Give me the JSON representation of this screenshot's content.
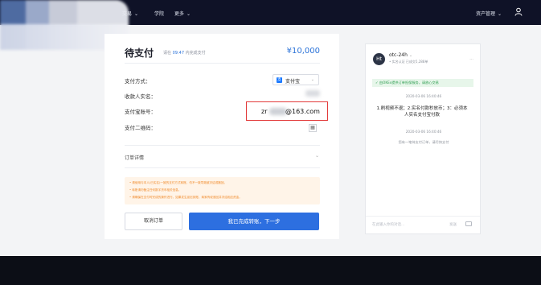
{
  "nav": {
    "items": [
      "交易",
      "学院",
      "更多"
    ],
    "asset_mgmt": "资产管理"
  },
  "order": {
    "title": "待支付",
    "subtitle_pre": "请在",
    "subtitle_time": "09:47",
    "subtitle_post": "内完成支付",
    "amount": "¥10,000",
    "labels": {
      "method": "支付方式：",
      "payee": "收款人实名：",
      "account": "支付宝账号：",
      "qrcode": "支付二维码："
    },
    "method_value": "支付宝",
    "account_prefix": "zr",
    "account_suffix": "@163.com",
    "order_detail": "订单详情",
    "notices": [
      "• 请使用与本人(已实名)一致的支付方式转账，勿不一致导致被冻结或撤回。",
      "• 转账请勿备注任何数字货币相关信息。",
      "• 请确保在支付时完成的操作进行。如果发生延迟到账，商家有权追回并冻结相应资金。"
    ],
    "cancel": "取消订单",
    "confirm": "我已完成转账，下一步"
  },
  "chat": {
    "avatar_text": "Ht",
    "name": "otc-24h",
    "meta": "• 实名认证  已成交5,288单",
    "banner": "✓ 由OKEx提供订单担保服务，请放心交易",
    "ts1": "2020-03-06 16:40:46",
    "message": "1.刷视频不退；2.实名付款秒放币；3：必须本人实名支付宝付款",
    "ts2": "2020-03-06 16:40:46",
    "system": "您有一笔待支付订单，请尽快支付",
    "input_placeholder": "在此输入你的对话...",
    "send": "发送"
  }
}
